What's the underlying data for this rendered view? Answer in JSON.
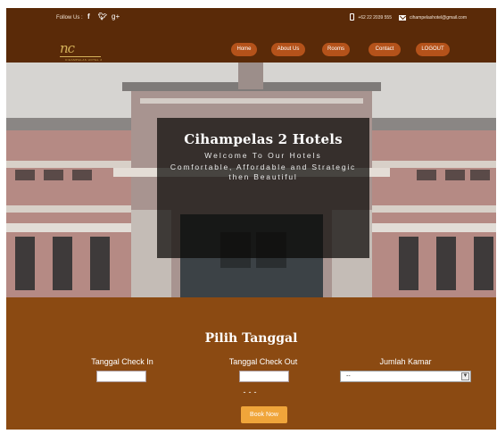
{
  "topbar": {
    "follow_label": "Follow Us :",
    "social_icons": [
      "facebook-icon",
      "twitter-icon",
      "google-plus-icon"
    ],
    "social_glyphs": [
      "f",
      "𝕪",
      "g+"
    ],
    "phone": "+62 22 2039 555",
    "email": "cihampelashotel@gmail.com"
  },
  "nav": {
    "logo_text": "nc",
    "logo_sub": "CIHAMPELAS HOTEL 2",
    "items": [
      {
        "label": "Home"
      },
      {
        "label": "About Us"
      },
      {
        "label": "Rooms"
      },
      {
        "label": "Contact"
      },
      {
        "label": "LOGOUT"
      }
    ]
  },
  "hero": {
    "title": "Cihampelas 2 Hotels",
    "subtitle": "Welcome To Our Hotels",
    "tagline": "Comfortable, Affordable and Strategic then Beautiful"
  },
  "booking": {
    "title": "Pilih Tanggal",
    "check_in_label": "Tanggal Check In",
    "check_in_value": "",
    "check_out_label": "Tanggal Check Out",
    "check_out_value": "",
    "rooms_label": "Jumlah Kamar",
    "rooms_selected": "--",
    "dash_text": "---",
    "book_button": "Book Now"
  },
  "colors": {
    "header_brown": "#5a2a08",
    "booking_brown": "#8b4a12",
    "nav_pill": "#b4521a",
    "button_orange": "#f0a53a",
    "logo_gold": "#d4b25a"
  }
}
